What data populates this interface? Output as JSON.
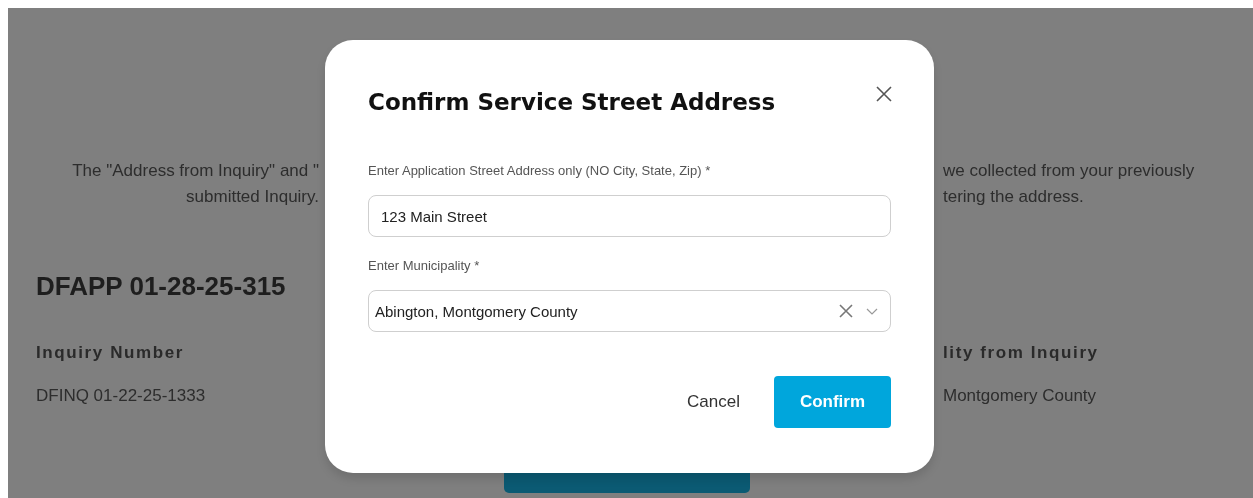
{
  "background_page": {
    "intro_left": [
      "The \"Address from Inquiry\" and \"",
      "submitted Inquiry."
    ],
    "intro_right": [
      "we collected from your previously",
      "tering the address."
    ],
    "application_id": "DFAPP 01-28-25-315",
    "fields_left": {
      "label": "Inquiry Number",
      "value": "DFINQ 01-22-25-1333"
    },
    "fields_right": {
      "label": "lity from Inquiry",
      "value": "Montgomery County"
    }
  },
  "dialog": {
    "title": "Confirm Service Street Address",
    "fields": [
      {
        "kind": "text",
        "label": "Enter Application Street Address only (NO City, State, Zip) *",
        "value": "123 Main Street"
      },
      {
        "kind": "select",
        "label": "Enter Municipality *",
        "value": "Abington, Montgomery County"
      }
    ],
    "buttons": [
      {
        "kind": "secondary",
        "label": "Cancel"
      },
      {
        "kind": "primary",
        "label": "Confirm"
      }
    ]
  }
}
